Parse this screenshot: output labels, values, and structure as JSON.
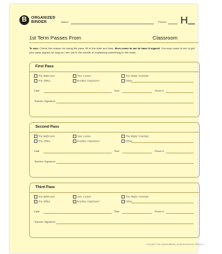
{
  "header": {
    "logo_letter": "B",
    "logo_line1": "ORGANIZED",
    "logo_line2": "BINDER",
    "name_label": "Name",
    "period_label": "Period",
    "code": "H"
  },
  "title": {
    "left": "1st Term Passes From",
    "right": "Classroom"
  },
  "intro": {
    "lead": "To use:",
    "part1": " Check the reason for using the pass, fill in the date and time, ",
    "emph": "then come to me to have it signed",
    "part2": ". You may come to me to get your pass signed as long as I am not in the middle of explaining something to the class."
  },
  "options": [
    "The Bathroom",
    "Your Locker",
    "The Water Fountain",
    "The Office",
    "Another Classroom",
    "Other"
  ],
  "fields": {
    "date": "Date",
    "time": "Time",
    "room": "Room #",
    "signature": "Teacher Signature"
  },
  "passes": [
    {
      "title": "First Pass"
    },
    {
      "title": "Second Pass"
    },
    {
      "title": "Third Pass"
    }
  ],
  "footer": "Copyright © 201 OrganizedBinder. All Rights Reserved. OB.EA.1.1"
}
